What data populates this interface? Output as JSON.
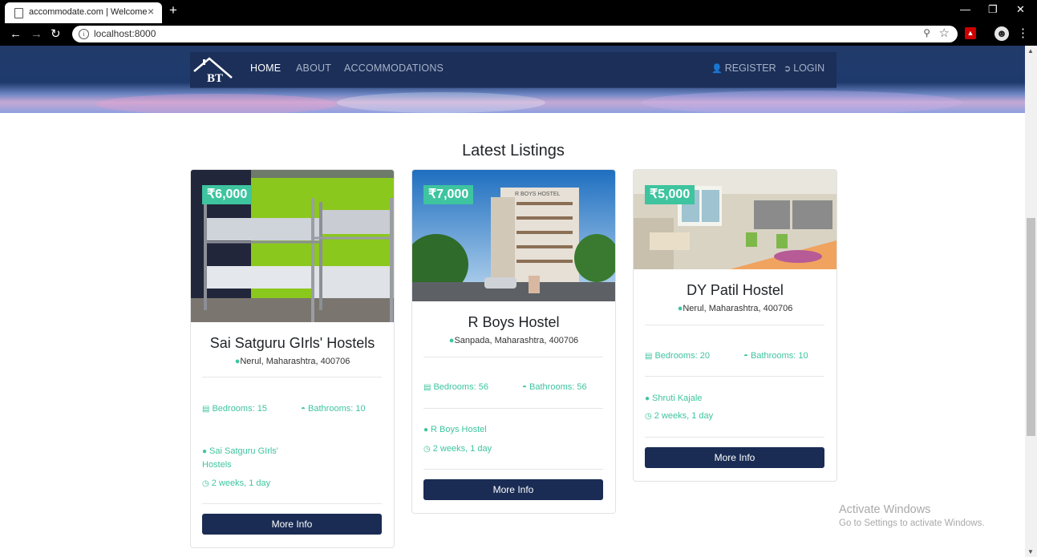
{
  "browser": {
    "tab_title": "accommodate.com | Welcome",
    "url": "localhost:8000",
    "new_tab_symbol": "+",
    "close_symbol": "×",
    "info_symbol": "i"
  },
  "navbar": {
    "logo_text": "BT",
    "links": [
      "HOME",
      "ABOUT",
      "ACCOMMODATIONS"
    ],
    "register": "REGISTER",
    "login": "LOGIN"
  },
  "section_title": "Latest Listings",
  "listings": [
    {
      "price": "₹6,000",
      "name": "Sai Satguru GIrls' Hostels",
      "location": "Nerul, Maharashtra, 400706",
      "bedrooms": "Bedrooms: 15",
      "bathrooms": "Bathrooms: 10",
      "owner_line1": "Sai Satguru GIrls'",
      "owner_line2": "Hostels",
      "time": "2 weeks, 1 day",
      "button": "More Info"
    },
    {
      "price": "₹7,000",
      "name": "R Boys Hostel",
      "location": "Sanpada, Maharashtra, 400706",
      "bedrooms": "Bedrooms: 56",
      "bathrooms": "Bathrooms: 56",
      "owner": "R Boys Hostel",
      "time": "2 weeks, 1 day",
      "button": "More Info",
      "sign_text": "R BOYS HOSTEL"
    },
    {
      "price": "₹5,000",
      "name": "DY Patil Hostel",
      "location": "Nerul, Maharashtra, 400706",
      "bedrooms": "Bedrooms: 20",
      "bathrooms": "Bathrooms: 10",
      "owner": "Shruti Kajale",
      "time": "2 weeks, 1 day",
      "button": "More Info"
    }
  ],
  "watermark": {
    "line1": "Activate Windows",
    "line2": "Go to Settings to activate Windows."
  },
  "colors": {
    "accent": "#3ec49f",
    "navy": "#1a2c54"
  }
}
